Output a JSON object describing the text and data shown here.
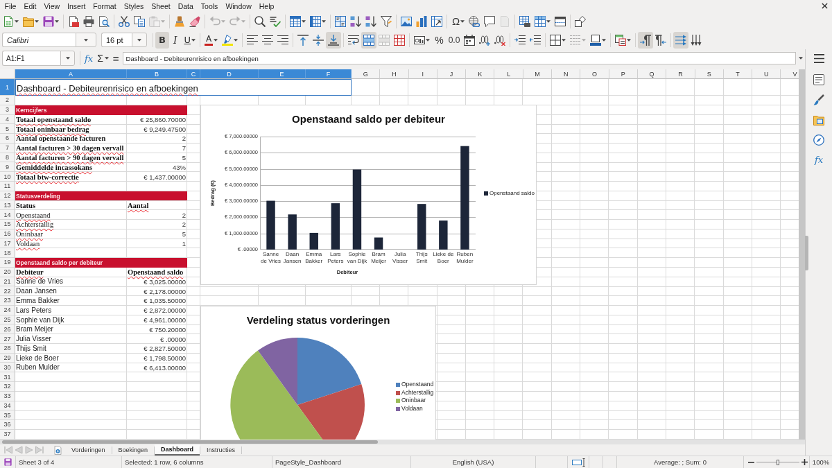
{
  "menu_bar": [
    "File",
    "Edit",
    "View",
    "Insert",
    "Format",
    "Styles",
    "Sheet",
    "Data",
    "Tools",
    "Window",
    "Help"
  ],
  "standard_toolbar": {
    "paste_disabled": true,
    "undo_disabled": true,
    "redo_disabled": true,
    "special_character": "Ω",
    "header_footer_disabled": true
  },
  "formatting_toolbar": {
    "font_name": "Calibri",
    "font_size": "16 pt",
    "bold": {
      "label": "B",
      "on": true
    },
    "italic": {
      "label": "I",
      "on": false
    },
    "underline": {
      "label": "U",
      "on": false
    },
    "font_color": "A",
    "align_left": false,
    "align_center": false,
    "align_right": false,
    "align_top": false,
    "align_middle": false,
    "align_bottom": true,
    "wrap_text": false,
    "merge_and_center": true,
    "merge_cells_disabled": true,
    "percent_format": "%",
    "number_format": "0.0",
    "border_style_disabled": true,
    "left_to_right": true,
    "right_to_left": false,
    "text_horizontal": true,
    "text_vertical": false
  },
  "formula_bar": {
    "name_box": "A1:F1",
    "function_wizard": "fx",
    "sum": "Σ",
    "equals": "=",
    "content": "Dashboard - Debiteurenrisico en afboekingen"
  },
  "sheet": {
    "columns": [
      {
        "label": "A",
        "selected": true
      },
      {
        "label": "B",
        "selected": true
      },
      {
        "label": "C",
        "selected": true
      },
      {
        "label": "D",
        "selected": true
      },
      {
        "label": "E",
        "selected": true
      },
      {
        "label": "F",
        "selected": true
      },
      {
        "label": "G",
        "selected": false
      },
      {
        "label": "H",
        "selected": false
      },
      {
        "label": "I",
        "selected": false
      },
      {
        "label": "J",
        "selected": false
      },
      {
        "label": "K",
        "selected": false
      },
      {
        "label": "L",
        "selected": false
      },
      {
        "label": "M",
        "selected": false
      },
      {
        "label": "N",
        "selected": false
      },
      {
        "label": "O",
        "selected": false
      },
      {
        "label": "P",
        "selected": false
      },
      {
        "label": "Q",
        "selected": false
      },
      {
        "label": "R",
        "selected": false
      },
      {
        "label": "S",
        "selected": false
      },
      {
        "label": "T",
        "selected": false
      },
      {
        "label": "U",
        "selected": false
      },
      {
        "label": "V",
        "selected": false
      }
    ],
    "rows": [
      {
        "number": "1",
        "selected": true,
        "kind": "title",
        "cells": [
          {
            "text": "Dashboard - Debiteurenrisico en afboekingen",
            "spell_error": true
          }
        ]
      },
      {
        "number": "2",
        "selected": false
      },
      {
        "number": "3",
        "selected": false,
        "kind": "section",
        "cells": [
          {
            "text": "Kerncijfers"
          }
        ]
      },
      {
        "number": "4",
        "selected": false,
        "kind": "metric",
        "cells": [
          {
            "text": "Totaal openstaand saldo",
            "spell_error": true
          },
          {
            "text": "€ 25,860.70000"
          }
        ]
      },
      {
        "number": "5",
        "selected": false,
        "kind": "metric",
        "cells": [
          {
            "text": "Totaal oninbaar bedrag",
            "spell_error": true
          },
          {
            "text": "€ 9,249.47500"
          }
        ]
      },
      {
        "number": "6",
        "selected": false,
        "kind": "metric",
        "cells": [
          {
            "text": "Aantal openstaande facturen",
            "spell_error": false
          },
          {
            "text": "2"
          }
        ]
      },
      {
        "number": "7",
        "selected": false,
        "kind": "metric",
        "cells": [
          {
            "text": "Aantal facturen > 30 dagen vervall",
            "spell_error": true
          },
          {
            "text": "7"
          }
        ]
      },
      {
        "number": "8",
        "selected": false,
        "kind": "metric",
        "cells": [
          {
            "text": "Aantal facturen > 90 dagen vervall",
            "spell_error": true
          },
          {
            "text": "5"
          }
        ]
      },
      {
        "number": "9",
        "selected": false,
        "kind": "metric",
        "cells": [
          {
            "text": "Gemiddelde incassokans",
            "spell_error": true
          },
          {
            "text": "43%"
          }
        ]
      },
      {
        "number": "10",
        "selected": false,
        "kind": "metric",
        "cells": [
          {
            "text": "Totaal btw-correctie",
            "spell_error": true
          },
          {
            "text": "€ 1,437.00000"
          }
        ]
      },
      {
        "number": "11",
        "selected": false
      },
      {
        "number": "12",
        "selected": false,
        "kind": "section",
        "cells": [
          {
            "text": "Statusverdeling"
          }
        ]
      },
      {
        "number": "13",
        "selected": false,
        "kind": "header",
        "cells": [
          {
            "text": "Status",
            "spell_error": false
          },
          {
            "text": "Aantal",
            "spell_error": true
          }
        ]
      },
      {
        "number": "14",
        "selected": false,
        "kind": "status",
        "cells": [
          {
            "text": "Openstaand",
            "spell_error": true
          },
          {
            "text": "2"
          }
        ]
      },
      {
        "number": "15",
        "selected": false,
        "kind": "status",
        "cells": [
          {
            "text": "Achterstallig",
            "spell_error": true
          },
          {
            "text": "2"
          }
        ]
      },
      {
        "number": "16",
        "selected": false,
        "kind": "status",
        "cells": [
          {
            "text": "Oninbaar",
            "spell_error": true
          },
          {
            "text": "5"
          }
        ]
      },
      {
        "number": "17",
        "selected": false,
        "kind": "status",
        "cells": [
          {
            "text": "Voldaan",
            "spell_error": true
          },
          {
            "text": "1"
          }
        ]
      },
      {
        "number": "18",
        "selected": false
      },
      {
        "number": "19",
        "selected": false,
        "kind": "section",
        "cells": [
          {
            "text": "Openstaand saldo per debiteur"
          }
        ]
      },
      {
        "number": "20",
        "selected": false,
        "kind": "header",
        "cells": [
          {
            "text": "Debiteur",
            "spell_error": true
          },
          {
            "text": "Openstaand saldo",
            "spell_error": true
          }
        ]
      },
      {
        "number": "21",
        "selected": false,
        "kind": "debtor",
        "cells": [
          {
            "text": "Sanne de Vries",
            "spell_error": false
          },
          {
            "text": "€ 3,025.00000"
          }
        ]
      },
      {
        "number": "22",
        "selected": false,
        "kind": "debtor",
        "cells": [
          {
            "text": "Daan Jansen",
            "spell_error": false
          },
          {
            "text": "€ 2,178.00000"
          }
        ]
      },
      {
        "number": "23",
        "selected": false,
        "kind": "debtor",
        "cells": [
          {
            "text": "Emma Bakker",
            "spell_error": false
          },
          {
            "text": "€ 1,035.50000"
          }
        ]
      },
      {
        "number": "24",
        "selected": false,
        "kind": "debtor",
        "cells": [
          {
            "text": "Lars Peters",
            "spell_error": false
          },
          {
            "text": "€ 2,872.00000"
          }
        ]
      },
      {
        "number": "25",
        "selected": false,
        "kind": "debtor",
        "cells": [
          {
            "text": "Sophie van Dijk",
            "spell_error": false
          },
          {
            "text": "€ 4,961.00000"
          }
        ]
      },
      {
        "number": "26",
        "selected": false,
        "kind": "debtor",
        "cells": [
          {
            "text": "Bram Meijer",
            "spell_error": false
          },
          {
            "text": "€ 750.20000"
          }
        ]
      },
      {
        "number": "27",
        "selected": false,
        "kind": "debtor",
        "cells": [
          {
            "text": "Julia Visser",
            "spell_error": false
          },
          {
            "text": "€ .00000"
          }
        ]
      },
      {
        "number": "28",
        "selected": false,
        "kind": "debtor",
        "cells": [
          {
            "text": "Thijs Smit",
            "spell_error": false
          },
          {
            "text": "€ 2,827.50000"
          }
        ]
      },
      {
        "number": "29",
        "selected": false,
        "kind": "debtor",
        "cells": [
          {
            "text": "Lieke de Boer",
            "spell_error": false
          },
          {
            "text": "€ 1,798.50000"
          }
        ]
      },
      {
        "number": "30",
        "selected": false,
        "kind": "debtor",
        "cells": [
          {
            "text": "Ruben Mulder",
            "spell_error": false
          },
          {
            "text": "€ 6,413.00000"
          }
        ]
      },
      {
        "number": "31",
        "selected": false
      },
      {
        "number": "32",
        "selected": false
      },
      {
        "number": "33",
        "selected": false
      },
      {
        "number": "34",
        "selected": false
      },
      {
        "number": "35",
        "selected": false
      },
      {
        "number": "36",
        "selected": false
      },
      {
        "number": "37",
        "selected": false
      }
    ],
    "bar_chart": {
      "chart_data": {
        "type": "bar",
        "title": "Openstaand saldo per debiteur",
        "xlabel": "Debiteur",
        "ylabel": "Bedrag (€)",
        "categories": [
          "Sanne de Vries",
          "Daan Jansen",
          "Emma Bakker",
          "Lars Peters",
          "Sophie van Dijk",
          "Bram Meijer",
          "Julia Visser",
          "Thijs Smit",
          "Lieke de Boer",
          "Ruben Mulder"
        ],
        "series": [
          {
            "name": "Openstaand saldo",
            "color": "#1d2639",
            "values": [
              3025,
              2178,
              1035.5,
              2872,
              4961,
              750.2,
              0,
              2827.5,
              1798.5,
              6413
            ]
          }
        ],
        "ylim": [
          0,
          7000
        ],
        "yticks": [
          {
            "value": 0,
            "label": "€ .00000"
          },
          {
            "value": 1000,
            "label": "€ 1,000.00000"
          },
          {
            "value": 2000,
            "label": "€ 2,000.00000"
          },
          {
            "value": 3000,
            "label": "€ 3,000.00000"
          },
          {
            "value": 4000,
            "label": "€ 4,000.00000"
          },
          {
            "value": 5000,
            "label": "€ 5,000.00000"
          },
          {
            "value": 6000,
            "label": "€ 6,000.00000"
          },
          {
            "value": 7000,
            "label": "€ 7,000.00000"
          }
        ],
        "grid": true,
        "legend": true
      }
    },
    "pie_chart": {
      "chart_data": {
        "type": "pie",
        "title": "Verdeling status vorderingen",
        "categories": [
          "Openstaand",
          "Achterstallig",
          "Oninbaar",
          "Voldaan"
        ],
        "series": [
          {
            "values": [
              20,
              20,
              50,
              10
            ]
          }
        ],
        "colors": [
          "#4f81bd",
          "#c0504d",
          "#9bbb59",
          "#8064a2"
        ],
        "legend": true
      }
    }
  },
  "sheet_tabs": [
    {
      "label": "Vorderingen",
      "selected": false
    },
    {
      "label": "Boekingen",
      "selected": false
    },
    {
      "label": "Dashboard",
      "selected": true
    },
    {
      "label": "Instructies",
      "selected": false
    }
  ],
  "sidebar": {
    "functions": "fx"
  },
  "status_bar": {
    "sheet_position": "Sheet 3 of 4",
    "selection": "Selected: 1 row, 6 columns",
    "page_style": "PageStyle_Dashboard",
    "language": "English (USA)",
    "summary": "Average: ; Sum: 0",
    "zoom": {
      "level": 0.5,
      "reading": "100%"
    }
  }
}
